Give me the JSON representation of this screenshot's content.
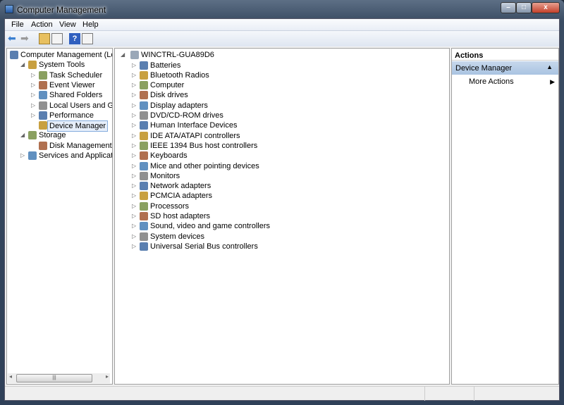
{
  "window": {
    "title": "Computer Management",
    "minimize": "–",
    "maximize": "□",
    "close": "x"
  },
  "menu": [
    "File",
    "Action",
    "View",
    "Help"
  ],
  "toolbar": {
    "buttons": [
      "back-icon",
      "forward-icon",
      "up-icon",
      "show-hide-console-tree-icon",
      "help-icon",
      "show-hide-action-pane-icon"
    ]
  },
  "left_tree": [
    {
      "label": "Computer Management (Local)",
      "level": 0,
      "exp": "",
      "icon": "computer-management-icon"
    },
    {
      "label": "System Tools",
      "level": 1,
      "exp": "◢",
      "icon": "tools-icon"
    },
    {
      "label": "Task Scheduler",
      "level": 2,
      "exp": "▷",
      "icon": "clock-icon"
    },
    {
      "label": "Event Viewer",
      "level": 2,
      "exp": "▷",
      "icon": "event-viewer-icon"
    },
    {
      "label": "Shared Folders",
      "level": 2,
      "exp": "▷",
      "icon": "shared-folder-icon"
    },
    {
      "label": "Local Users and Groups",
      "level": 2,
      "exp": "▷",
      "icon": "users-icon"
    },
    {
      "label": "Performance",
      "level": 2,
      "exp": "▷",
      "icon": "performance-icon"
    },
    {
      "label": "Device Manager",
      "level": 2,
      "exp": "",
      "icon": "device-manager-icon",
      "selected": true
    },
    {
      "label": "Storage",
      "level": 1,
      "exp": "◢",
      "icon": "storage-icon"
    },
    {
      "label": "Disk Management",
      "level": 2,
      "exp": "",
      "icon": "disk-icon"
    },
    {
      "label": "Services and Applications",
      "level": 1,
      "exp": "▷",
      "icon": "services-icon"
    }
  ],
  "device_tree": {
    "root": "WINCTRL-GUA89D6",
    "items": [
      "Batteries",
      "Bluetooth Radios",
      "Computer",
      "Disk drives",
      "Display adapters",
      "DVD/CD-ROM drives",
      "Human Interface Devices",
      "IDE ATA/ATAPI controllers",
      "IEEE 1394 Bus host controllers",
      "Keyboards",
      "Mice and other pointing devices",
      "Monitors",
      "Network adapters",
      "PCMCIA adapters",
      "Processors",
      "SD host adapters",
      "Sound, video and game controllers",
      "System devices",
      "Universal Serial Bus controllers"
    ]
  },
  "actions": {
    "header": "Actions",
    "section": "Device Manager",
    "items": [
      "More Actions"
    ]
  },
  "colors": {
    "accent": "#a9c3e1",
    "close": "#c4402a"
  }
}
